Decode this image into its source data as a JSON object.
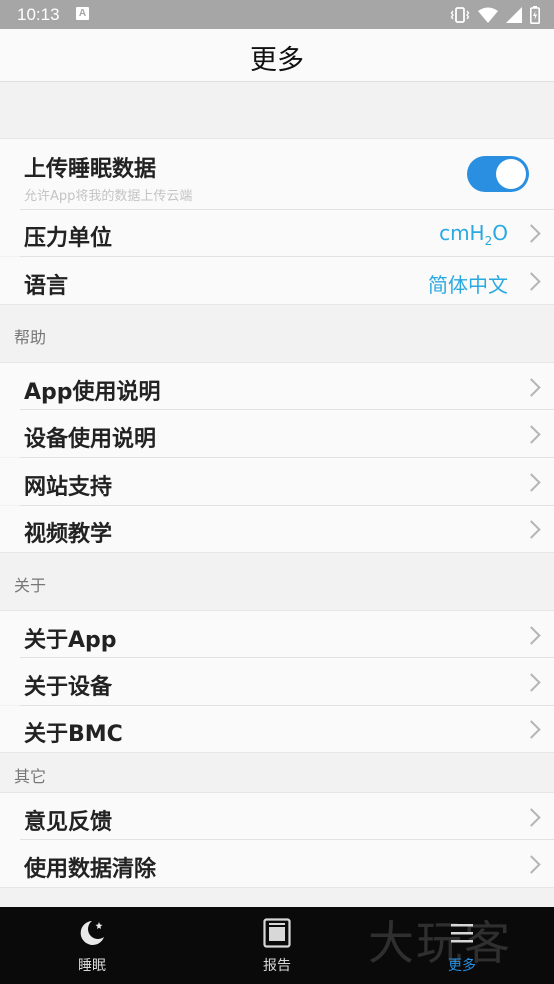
{
  "status_bar": {
    "time": "10:13",
    "notif_badge": "A"
  },
  "header": {
    "title": "更多"
  },
  "settings": {
    "upload": {
      "label": "上传睡眠数据",
      "sub": "允许App将我的数据上传云端",
      "enabled": true
    },
    "pressure": {
      "label": "压力单位",
      "value_main": "cmH",
      "value_sub": "2",
      "value_end": "O"
    },
    "language": {
      "label": "语言",
      "value": "简体中文"
    }
  },
  "help": {
    "section": "帮助",
    "items": [
      {
        "label": "App使用说明"
      },
      {
        "label": "设备使用说明"
      },
      {
        "label": "网站支持"
      },
      {
        "label": "视频教学"
      }
    ]
  },
  "about": {
    "section": "关于",
    "items": [
      {
        "label": "关于App"
      },
      {
        "label": "关于设备"
      },
      {
        "label": "关于BMC"
      }
    ]
  },
  "other": {
    "section": "其它",
    "items": [
      {
        "label": "意见反馈"
      },
      {
        "label": "使用数据清除"
      }
    ]
  },
  "tabs": [
    {
      "label": "睡眠",
      "icon": "moon-star-icon"
    },
    {
      "label": "报告",
      "icon": "report-icon"
    },
    {
      "label": "更多",
      "icon": "more-icon",
      "active": true
    }
  ],
  "watermark": "大玩客",
  "colors": {
    "accent": "#2a8fe0",
    "value_text": "#29a9e0",
    "tabbar_bg": "#0a0a0a",
    "statusbar_bg": "#a6a6a6"
  }
}
